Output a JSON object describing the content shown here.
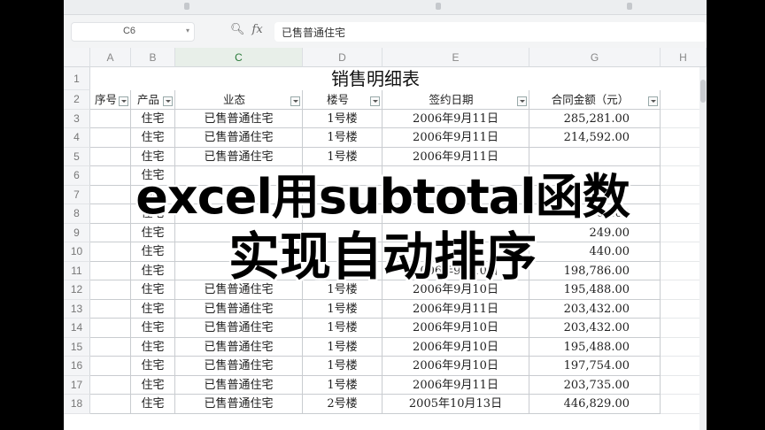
{
  "formula_bar": {
    "cell_ref": "C6",
    "formula": "已售普通住宅"
  },
  "columns": [
    "A",
    "B",
    "C",
    "D",
    "E",
    "G",
    "H"
  ],
  "sheet": {
    "title": "销售明细表",
    "headers": [
      "序号",
      "产品",
      "业态",
      "楼号",
      "签约日期",
      "合同金额（元）"
    ],
    "row_numbers": [
      "1",
      "2",
      "3",
      "4",
      "5",
      "6",
      "7",
      "8",
      "9",
      "10",
      "11",
      "12",
      "13",
      "14",
      "15",
      "16",
      "17",
      "18"
    ],
    "rows": [
      {
        "product": "住宅",
        "type": "已售普通住宅",
        "building": "1号楼",
        "date": "2006年9月11日",
        "amount": "285,281.00"
      },
      {
        "product": "住宅",
        "type": "已售普通住宅",
        "building": "1号楼",
        "date": "2006年9月11日",
        "amount": "214,592.00"
      },
      {
        "product": "住宅",
        "type": "已售普通住宅",
        "building": "1号楼",
        "date": "2006年9月11日",
        "amount": ""
      },
      {
        "product": "住宅",
        "type": "",
        "building": "",
        "date": "",
        "amount": ""
      },
      {
        "product": "住宅",
        "type": "",
        "building": "",
        "date": "",
        "amount": ""
      },
      {
        "product": "住宅",
        "type": "",
        "building": "",
        "date": "",
        "amount": "604.00"
      },
      {
        "product": "住宅",
        "type": "",
        "building": "",
        "date": "",
        "amount": "249.00"
      },
      {
        "product": "住宅",
        "type": "",
        "building": "",
        "date": "",
        "amount": "440.00"
      },
      {
        "product": "住宅",
        "type": "",
        "building": "",
        "date": "2006年9月10日",
        "amount": "198,786.00"
      },
      {
        "product": "住宅",
        "type": "已售普通住宅",
        "building": "1号楼",
        "date": "2006年9月10日",
        "amount": "195,488.00"
      },
      {
        "product": "住宅",
        "type": "已售普通住宅",
        "building": "1号楼",
        "date": "2006年9月11日",
        "amount": "203,432.00"
      },
      {
        "product": "住宅",
        "type": "已售普通住宅",
        "building": "1号楼",
        "date": "2006年9月10日",
        "amount": "203,432.00"
      },
      {
        "product": "住宅",
        "type": "已售普通住宅",
        "building": "1号楼",
        "date": "2006年9月10日",
        "amount": "195,488.00"
      },
      {
        "product": "住宅",
        "type": "已售普通住宅",
        "building": "1号楼",
        "date": "2006年9月10日",
        "amount": "197,754.00"
      },
      {
        "product": "住宅",
        "type": "已售普通住宅",
        "building": "1号楼",
        "date": "2006年9月11日",
        "amount": "203,735.00"
      },
      {
        "product": "住宅",
        "type": "已售普通住宅",
        "building": "2号楼",
        "date": "2005年10月13日",
        "amount": "446,829.00"
      }
    ]
  },
  "overlay": {
    "line1": "excel用subtotal函数",
    "line2": "实现自动排序"
  },
  "icons": {
    "zoom": "zoom-icon",
    "fx": "fx-icon",
    "dropdown": "chevron-down-icon",
    "filter": "filter-dropdown-icon"
  },
  "colors": {
    "selected_column": "#2a7a3a"
  }
}
